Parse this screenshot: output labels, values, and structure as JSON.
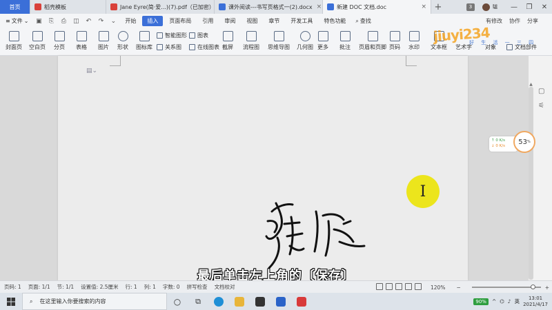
{
  "tabs": [
    {
      "label": "首页",
      "active": false,
      "icon_color": "#3b6fd8"
    },
    {
      "label": "稻壳模板",
      "active": false,
      "icon_color": "#d9413a"
    },
    {
      "label": "Jane Eyre(简·爱...)(7).pdf（已加密）",
      "active": false,
      "icon_color": "#d9413a"
    },
    {
      "label": "课外阅读---书写页格式一(2).docx",
      "active": false,
      "icon_color": "#3b6fd8"
    },
    {
      "label": "新建 DOC 文档.doc",
      "active": true,
      "icon_color": "#3b6fd8"
    }
  ],
  "titlebar": {
    "new_tab": "+",
    "badge": "3",
    "user": "驢"
  },
  "menu": {
    "file": "文件",
    "tabs": [
      "开始",
      "插入",
      "页面布局",
      "引用",
      "审阅",
      "视图",
      "章节",
      "开发工具",
      "特色功能"
    ],
    "active_tab": "插入",
    "search": "查找",
    "right": [
      "有修改",
      "协作",
      "分享"
    ]
  },
  "ribbon": {
    "large": [
      "封面页",
      "空白页",
      "分页",
      "表格",
      "图片",
      "形状",
      "图标库",
      "在线图表",
      "截屏",
      "流程图",
      "思维导图",
      "几何图",
      "更多",
      "批注",
      "页眉和页脚",
      "页码",
      "水印",
      "文本框",
      "艺术字",
      "对象",
      "文档部件"
    ],
    "small": [
      "智能图形",
      "图表",
      "关系图"
    ]
  },
  "watermark": {
    "main": "jiuyi234",
    "sub": "好 生 活 一 三 四"
  },
  "speed_widget": {
    "up": "↑ 0  K/s",
    "down": "↓ 0  K/s",
    "percent": "53",
    "unit": "%"
  },
  "cursor_glyph": "I",
  "subtitle": "最后单击左上角的〔保存〕",
  "statusbar": {
    "page_num": "页码: 1",
    "pages": "页面: 1/1",
    "section": "节: 1/1",
    "setting": "设置值: 2.5厘米",
    "row": "行: 1",
    "col": "列: 1",
    "words": "字数: 0",
    "spell": "拼写检查",
    "compare": "文档校对",
    "zoom": "120%",
    "zoom_level": 0.85
  },
  "taskbar": {
    "search_placeholder": "在这里输入你要搜索的内容",
    "battery": "90%",
    "ime": "英",
    "time": "13:01",
    "date": "2021/4/17"
  }
}
